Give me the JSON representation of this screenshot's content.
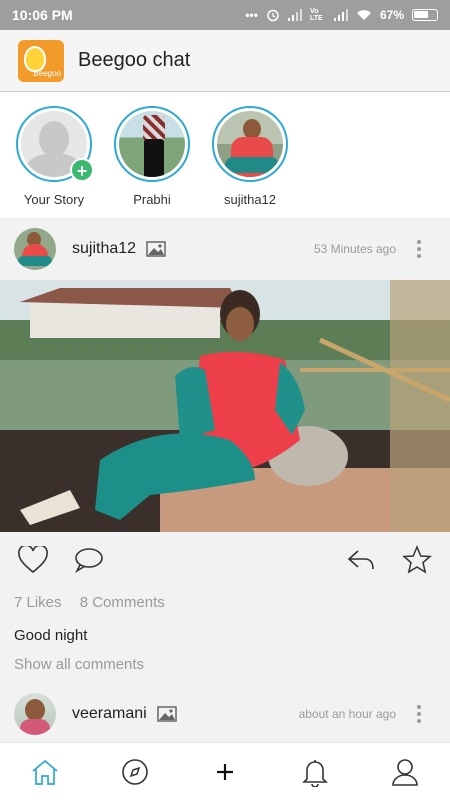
{
  "status_bar": {
    "time": "10:06 PM",
    "battery": "67%",
    "network_label": "Vo LTE"
  },
  "app_bar": {
    "title": "Beegoo chat",
    "logo_text": "Beegoo"
  },
  "stories": [
    {
      "label": "Your Story",
      "type": "own",
      "add_icon": "plus-icon"
    },
    {
      "label": "Prabhi",
      "type": "friend"
    },
    {
      "label": "sujitha12",
      "type": "friend"
    }
  ],
  "posts": [
    {
      "username": "sujitha12",
      "timestamp": "53 Minutes ago",
      "likes": "7 Likes",
      "comments": "8 Comments",
      "caption": "Good night",
      "show_all": "Show all comments"
    },
    {
      "username": "veeramani",
      "timestamp": "about an hour ago"
    }
  ],
  "bottom_nav": [
    {
      "name": "home",
      "icon": "home-icon",
      "active": true
    },
    {
      "name": "explore",
      "icon": "compass-icon",
      "active": false
    },
    {
      "name": "add",
      "icon": "plus-icon",
      "active": false
    },
    {
      "name": "notifications",
      "icon": "bell-icon",
      "active": false
    },
    {
      "name": "profile",
      "icon": "user-icon",
      "active": false
    }
  ],
  "colors": {
    "accent": "#2ea8d6",
    "status_bar": "#9e9e9e",
    "add_badge": "#3ab86f",
    "logo": "#f29b2a"
  }
}
